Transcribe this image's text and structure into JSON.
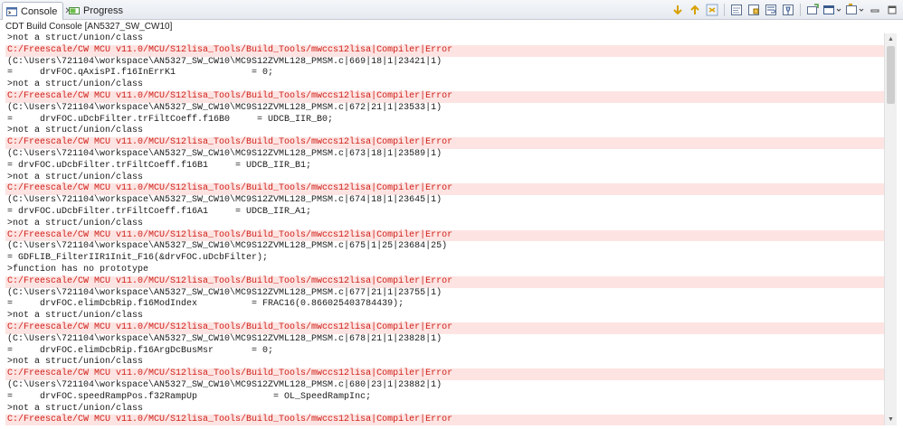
{
  "tabs": [
    {
      "label": "Console",
      "icon": "console-icon",
      "active": true
    },
    {
      "label": "Progress",
      "icon": "progress-icon",
      "active": false
    }
  ],
  "tab_close_glyph": "✕",
  "subtitle": "CDT Build Console [AN5327_SW_CW10]",
  "colors": {
    "error_text": "#d0211b",
    "error_bg": "#fde4e2",
    "normal_text": "#1a1a1a"
  },
  "toolbar_icons": [
    "next-annotation-icon",
    "previous-annotation-icon",
    "link-icon",
    "clear-console-icon",
    "scroll-lock-icon",
    "word-wrap-icon",
    "pin-console-icon",
    "display-selected-console-icon",
    "open-console-icon",
    "minimize-icon",
    "maximize-icon"
  ],
  "console_lines": [
    {
      "text": ">not a struct/union/class",
      "error": false
    },
    {
      "text": "C:/Freescale/CW MCU v11.0/MCU/S12lisa_Tools/Build_Tools/mwccs12lisa|Compiler|Error",
      "error": true
    },
    {
      "text": "(C:\\Users\\721104\\workspace\\AN5327_SW_CW10\\MC9S12ZVML128_PMSM.c|669|18|1|23421|1)",
      "error": false
    },
    {
      "text": "=     drvFOC.qAxisPI.f16InErrK1              = 0;",
      "error": false
    },
    {
      "text": ">not a struct/union/class",
      "error": false
    },
    {
      "text": "C:/Freescale/CW MCU v11.0/MCU/S12lisa_Tools/Build_Tools/mwccs12lisa|Compiler|Error",
      "error": true
    },
    {
      "text": "(C:\\Users\\721104\\workspace\\AN5327_SW_CW10\\MC9S12ZVML128_PMSM.c|672|21|1|23533|1)",
      "error": false
    },
    {
      "text": "=     drvFOC.uDcbFilter.trFiltCoeff.f16B0     = UDCB_IIR_B0;",
      "error": false
    },
    {
      "text": ">not a struct/union/class",
      "error": false
    },
    {
      "text": "C:/Freescale/CW MCU v11.0/MCU/S12lisa_Tools/Build_Tools/mwccs12lisa|Compiler|Error",
      "error": true
    },
    {
      "text": "(C:\\Users\\721104\\workspace\\AN5327_SW_CW10\\MC9S12ZVML128_PMSM.c|673|18|1|23589|1)",
      "error": false
    },
    {
      "text": "= drvFOC.uDcbFilter.trFiltCoeff.f16B1     = UDCB_IIR_B1;",
      "error": false
    },
    {
      "text": ">not a struct/union/class",
      "error": false
    },
    {
      "text": "C:/Freescale/CW MCU v11.0/MCU/S12lisa_Tools/Build_Tools/mwccs12lisa|Compiler|Error",
      "error": true
    },
    {
      "text": "(C:\\Users\\721104\\workspace\\AN5327_SW_CW10\\MC9S12ZVML128_PMSM.c|674|18|1|23645|1)",
      "error": false
    },
    {
      "text": "= drvFOC.uDcbFilter.trFiltCoeff.f16A1     = UDCB_IIR_A1;",
      "error": false
    },
    {
      "text": ">not a struct/union/class",
      "error": false
    },
    {
      "text": "C:/Freescale/CW MCU v11.0/MCU/S12lisa_Tools/Build_Tools/mwccs12lisa|Compiler|Error",
      "error": true
    },
    {
      "text": "(C:\\Users\\721104\\workspace\\AN5327_SW_CW10\\MC9S12ZVML128_PMSM.c|675|1|25|23684|25)",
      "error": false
    },
    {
      "text": "= GDFLIB_FilterIIR1Init_F16(&drvFOC.uDcbFilter);",
      "error": false
    },
    {
      "text": ">function has no prototype",
      "error": false
    },
    {
      "text": "C:/Freescale/CW MCU v11.0/MCU/S12lisa_Tools/Build_Tools/mwccs12lisa|Compiler|Error",
      "error": true
    },
    {
      "text": "(C:\\Users\\721104\\workspace\\AN5327_SW_CW10\\MC9S12ZVML128_PMSM.c|677|21|1|23755|1)",
      "error": false
    },
    {
      "text": "=     drvFOC.elimDcbRip.f16ModIndex          = FRAC16(0.866025403784439);",
      "error": false
    },
    {
      "text": ">not a struct/union/class",
      "error": false
    },
    {
      "text": "C:/Freescale/CW MCU v11.0/MCU/S12lisa_Tools/Build_Tools/mwccs12lisa|Compiler|Error",
      "error": true
    },
    {
      "text": "(C:\\Users\\721104\\workspace\\AN5327_SW_CW10\\MC9S12ZVML128_PMSM.c|678|21|1|23828|1)",
      "error": false
    },
    {
      "text": "=     drvFOC.elimDcbRip.f16ArgDcBusMsr       = 0;",
      "error": false
    },
    {
      "text": ">not a struct/union/class",
      "error": false
    },
    {
      "text": "C:/Freescale/CW MCU v11.0/MCU/S12lisa_Tools/Build_Tools/mwccs12lisa|Compiler|Error",
      "error": true
    },
    {
      "text": "(C:\\Users\\721104\\workspace\\AN5327_SW_CW10\\MC9S12ZVML128_PMSM.c|680|23|1|23882|1)",
      "error": false
    },
    {
      "text": "=     drvFOC.speedRampPos.f32RampUp              = OL_SpeedRampInc;",
      "error": false
    },
    {
      "text": ">not a struct/union/class",
      "error": false
    },
    {
      "text": "C:/Freescale/CW MCU v11.0/MCU/S12lisa_Tools/Build_Tools/mwccs12lisa|Compiler|Error",
      "error": true
    }
  ]
}
